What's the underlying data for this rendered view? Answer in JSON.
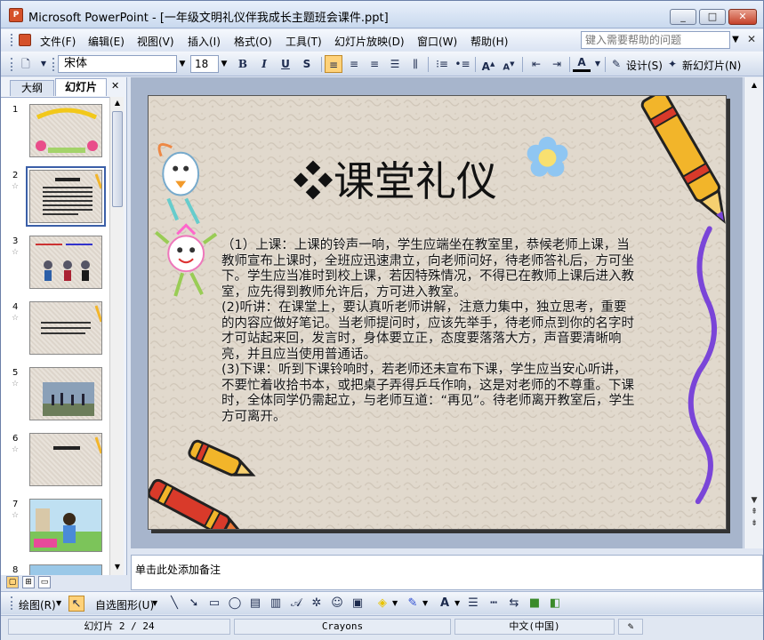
{
  "window": {
    "title": "Microsoft PowerPoint - [一年级文明礼仪伴我成长主题班会课件.ppt]",
    "app_icon_label": "P",
    "min": "_",
    "max": "□",
    "close": "✕"
  },
  "menu": {
    "items": [
      "文件(F)",
      "编辑(E)",
      "视图(V)",
      "插入(I)",
      "格式(O)",
      "工具(T)",
      "幻灯片放映(D)",
      "窗口(W)",
      "帮助(H)"
    ],
    "help_placeholder": "键入需要帮助的问题",
    "close_doc": "✕"
  },
  "toolbar": {
    "font": "宋体",
    "size": "18",
    "bold": "B",
    "italic": "I",
    "underline": "U",
    "shadow": "S",
    "design": "设计(S)",
    "new_slide": "新幻灯片(N)"
  },
  "left_pane": {
    "tab_outline": "大纲",
    "tab_slides": "幻灯片",
    "close": "✕",
    "thumbs": [
      {
        "num": "1",
        "star": ""
      },
      {
        "num": "2",
        "star": "☆"
      },
      {
        "num": "3",
        "star": "☆"
      },
      {
        "num": "4",
        "star": "☆"
      },
      {
        "num": "5",
        "star": "☆"
      },
      {
        "num": "6",
        "star": "☆"
      },
      {
        "num": "7",
        "star": "☆"
      },
      {
        "num": "8",
        "star": ""
      }
    ]
  },
  "slide": {
    "title": "❖课堂礼仪",
    "paragraphs": [
      "（1）上课：上课的铃声一响，学生应端坐在教室里，恭候老师上课，当教师宣布上课时，全班应迅速肃立，向老师问好，待老师答礼后，方可坐下。学生应当准时到校上课，若因特殊情况，不得已在教师上课后进入教室，应先得到教师允许后，方可进入教室。",
      "(2)听讲：在课堂上，要认真听老师讲解，注意力集中，独立思考，重要的内容应做好笔记。当老师提问时，应该先举手，待老师点到你的名字时才可站起来回，发言时，身体要立正，态度要落落大方，声音要清晰响亮，并且应当使用普通话。",
      "(3)下课：听到下课铃响时，若老师还未宣布下课，学生应当安心听讲，不要忙着收拾书本，或把桌子弄得乒乓作响，这是对老师的不尊重。下课时，全体同学仍需起立，与老师互道：“再见”。待老师离开教室后，学生方可离开。"
    ]
  },
  "notes": {
    "placeholder": "单击此处添加备注"
  },
  "drawbar": {
    "draw": "绘图(R)",
    "autoshapes": "自选图形(U)"
  },
  "status": {
    "slide": "幻灯片 2 / 24",
    "design": "Crayons",
    "language": "中文(中国)"
  },
  "colors": {
    "slide_bg": "#e1d9cd",
    "crayon_yellow": "#f2b52a",
    "crayon_red": "#d93a2a",
    "squiggle_purple": "#7a45d8"
  }
}
